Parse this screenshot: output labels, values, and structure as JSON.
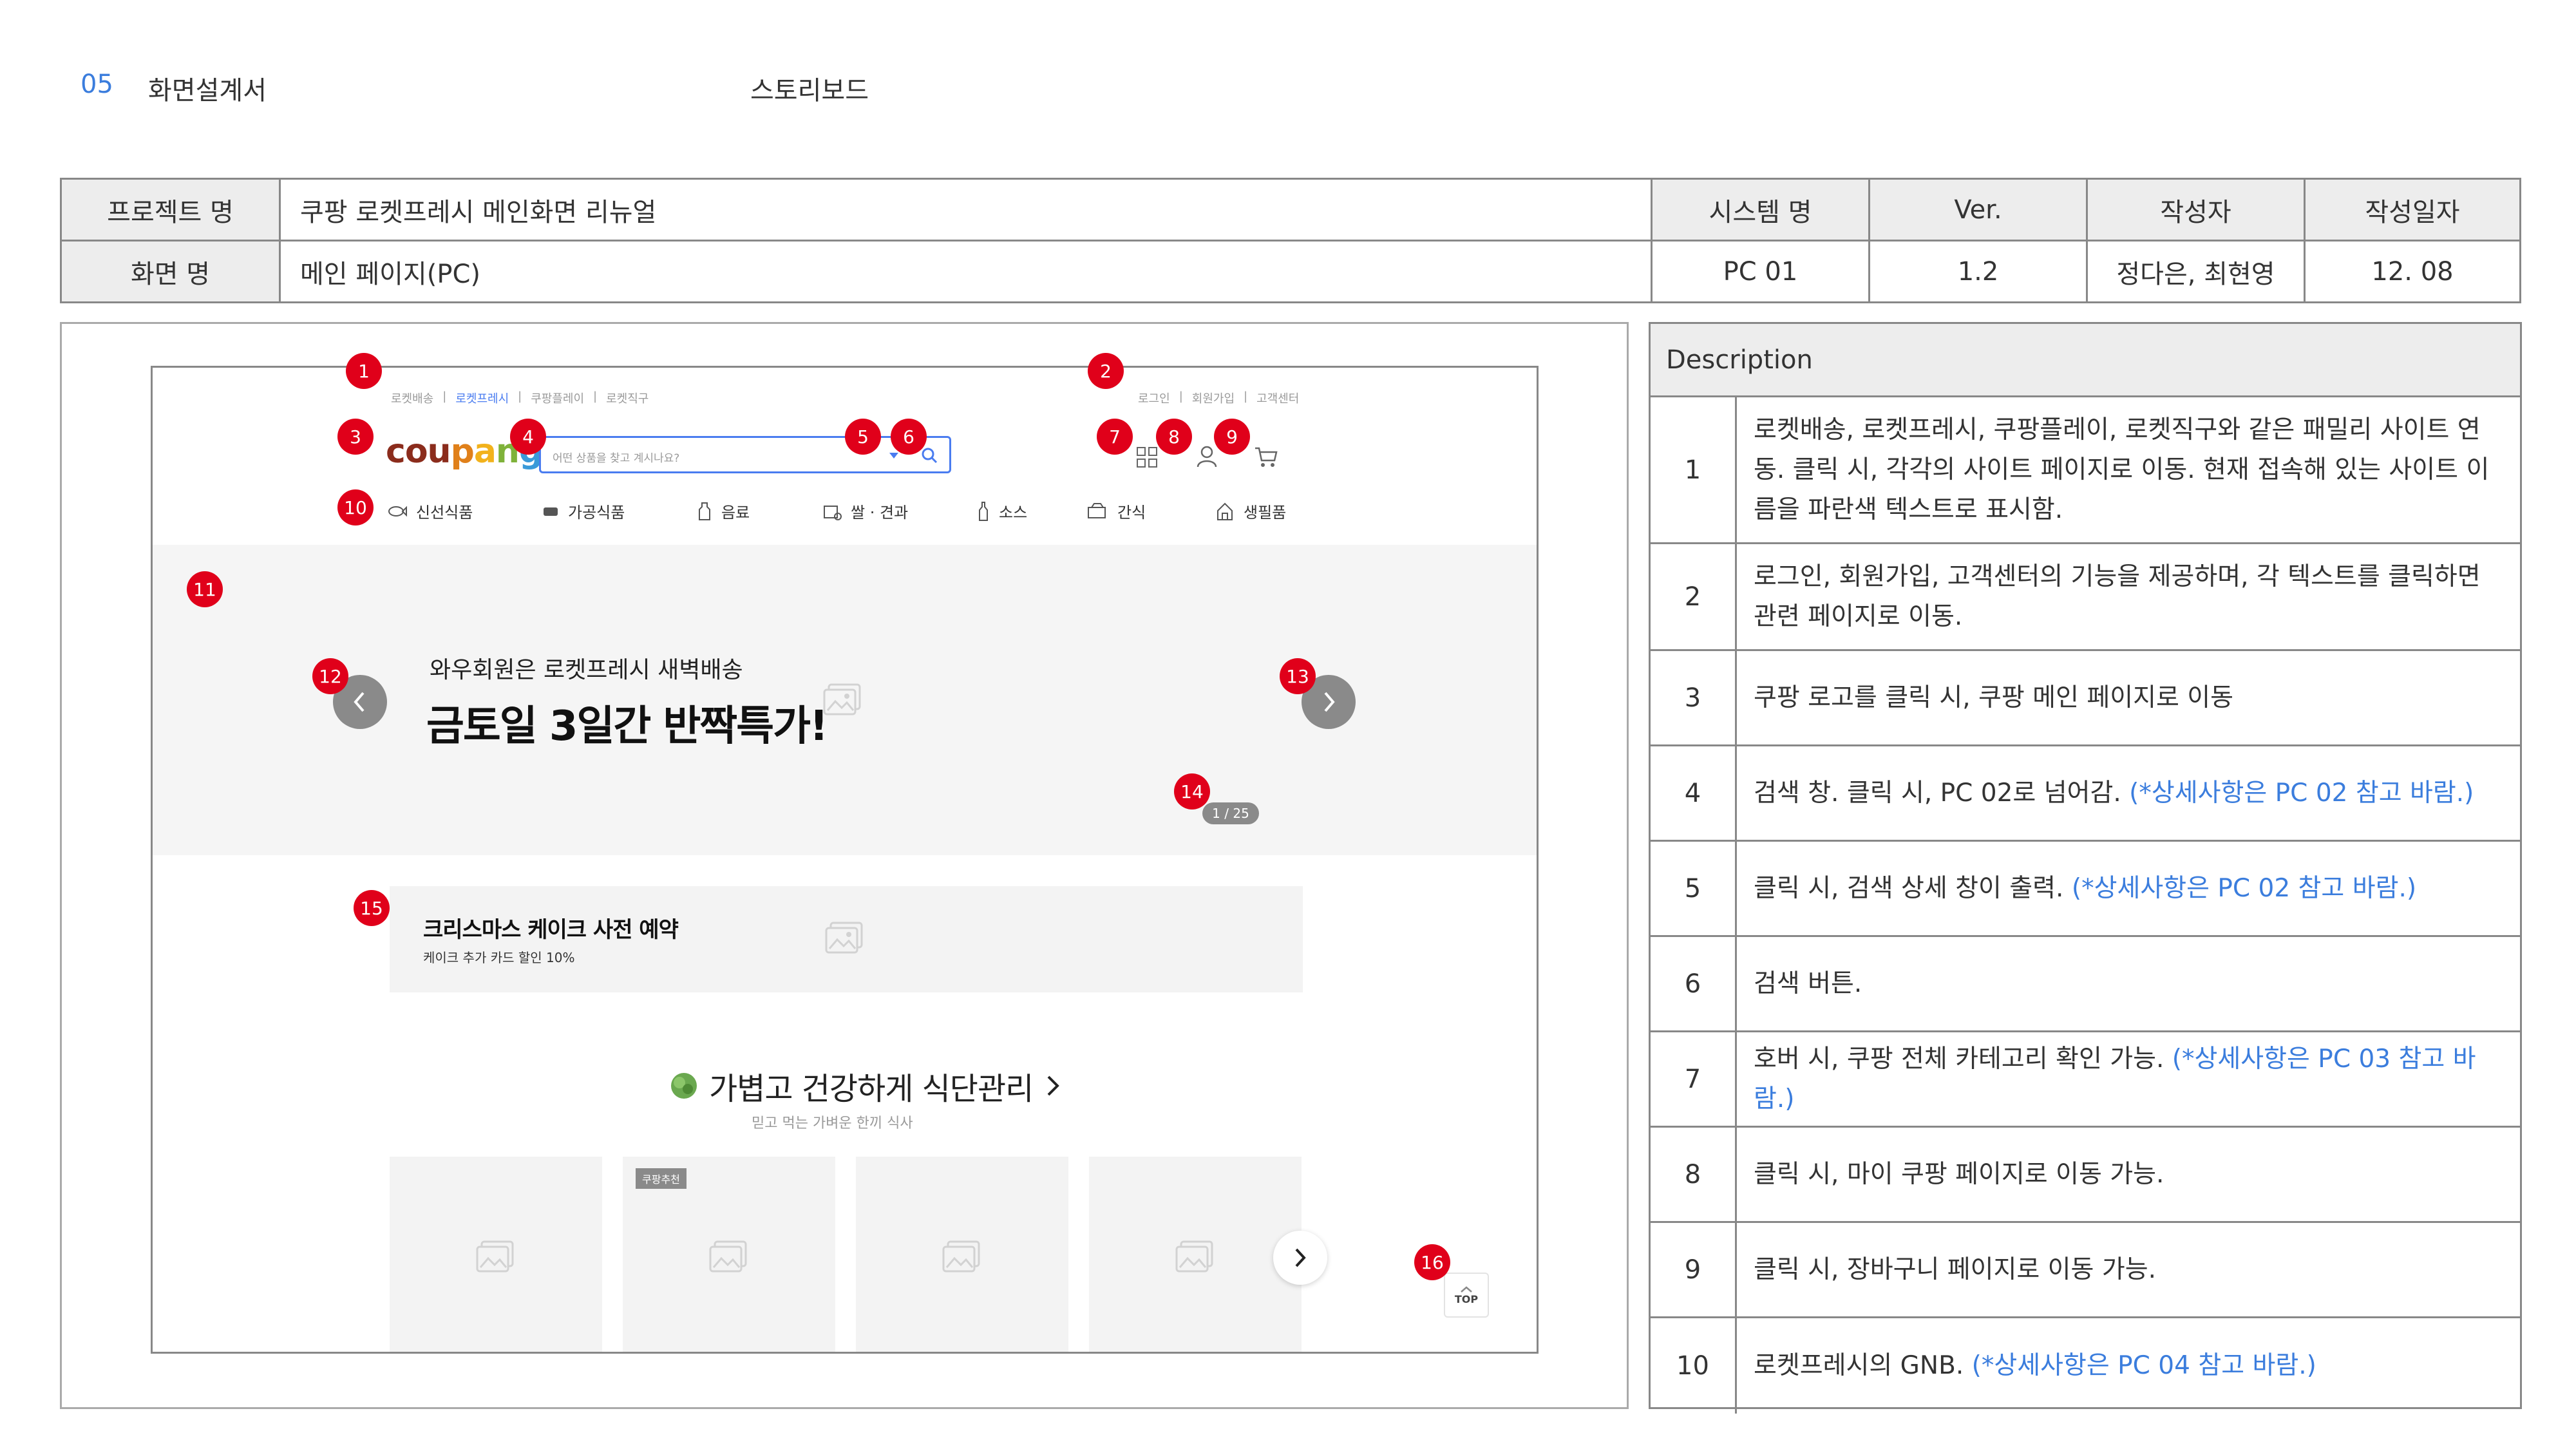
{
  "header": {
    "section_num": "05",
    "section_title": "화면설계서",
    "board_title": "스토리보드"
  },
  "info_table": {
    "project_label": "프로젝트 명",
    "project_value": "쿠팡 로켓프레시 메인화면 리뉴얼",
    "screen_label": "화면 명",
    "screen_value": "메인 페이지(PC)",
    "system_label": "시스템 명",
    "system_value": "PC 01",
    "ver_label": "Ver.",
    "ver_value": "1.2",
    "author_label": "작성자",
    "author_value": "정다은, 최현영",
    "date_label": "작성일자",
    "date_value": "12. 08"
  },
  "wireframe": {
    "family_links": [
      "로켓배송",
      "|",
      "로켓프레시",
      "|",
      "쿠팡플레이",
      "|",
      "로켓직구"
    ],
    "util_links": [
      "로그인",
      "|",
      "회원가입",
      "|",
      "고객센터"
    ],
    "logo": "coupang",
    "search_placeholder": "어떤 상품을 찾고 계시나요?",
    "gnb": [
      "신선식품",
      "가공식품",
      "음료",
      "쌀 · 견과",
      "소스",
      "간식",
      "생필품"
    ],
    "banner_sub": "와우회원은 로켓프레시 새벽배송",
    "banner_title": "금토일 3일간 반짝특가!",
    "banner_counter": "1 / 25",
    "promo_title": "크리스마스 케이크 사전 예약",
    "promo_sub": "케이크 추가 카드 할인 10%",
    "section_title": "가볍고 건강하게 식단관리",
    "section_sub": "믿고 먹는 가벼운 한끼 식사",
    "card_badge": "쿠팡추천",
    "top_label": "TOP",
    "markers": [
      "1",
      "2",
      "3",
      "4",
      "5",
      "6",
      "7",
      "8",
      "9",
      "10",
      "11",
      "12",
      "13",
      "14",
      "15",
      "16"
    ]
  },
  "description": {
    "header": "Description",
    "rows": [
      {
        "num": "1",
        "text": "로켓배송, 로켓프레시, 쿠팡플레이, 로켓직구와 같은 패밀리 사이트 연동. 클릭 시, 각각의 사이트 페이지로 이동. 현재 접속해 있는 사이트 이름을 파란색 텍스트로 표시함.",
        "note": ""
      },
      {
        "num": "2",
        "text": "로그인, 회원가입, 고객센터의 기능을 제공하며, 각 텍스트를 클릭하면 관련 페이지로 이동.",
        "note": ""
      },
      {
        "num": "3",
        "text": "쿠팡 로고를 클릭 시, 쿠팡 메인 페이지로 이동",
        "note": ""
      },
      {
        "num": "4",
        "text": "검색 창. 클릭 시, PC 02로 넘어감.",
        "note": "(*상세사항은 PC 02 참고 바람.)"
      },
      {
        "num": "5",
        "text": "클릭 시, 검색 상세 창이 출력.",
        "note": "(*상세사항은 PC 02 참고 바람.)"
      },
      {
        "num": "6",
        "text": "검색 버튼.",
        "note": ""
      },
      {
        "num": "7",
        "text": "호버 시, 쿠팡 전체 카테고리 확인 가능.",
        "note": "(*상세사항은 PC 03 참고 바람.)"
      },
      {
        "num": "8",
        "text": "클릭 시, 마이 쿠팡 페이지로 이동 가능.",
        "note": ""
      },
      {
        "num": "9",
        "text": "클릭 시, 장바구니 페이지로 이동 가능.",
        "note": ""
      },
      {
        "num": "10",
        "text": "로켓프레시의 GNB.",
        "note": "(*상세사항은 PC 04 참고 바람.)"
      }
    ]
  }
}
